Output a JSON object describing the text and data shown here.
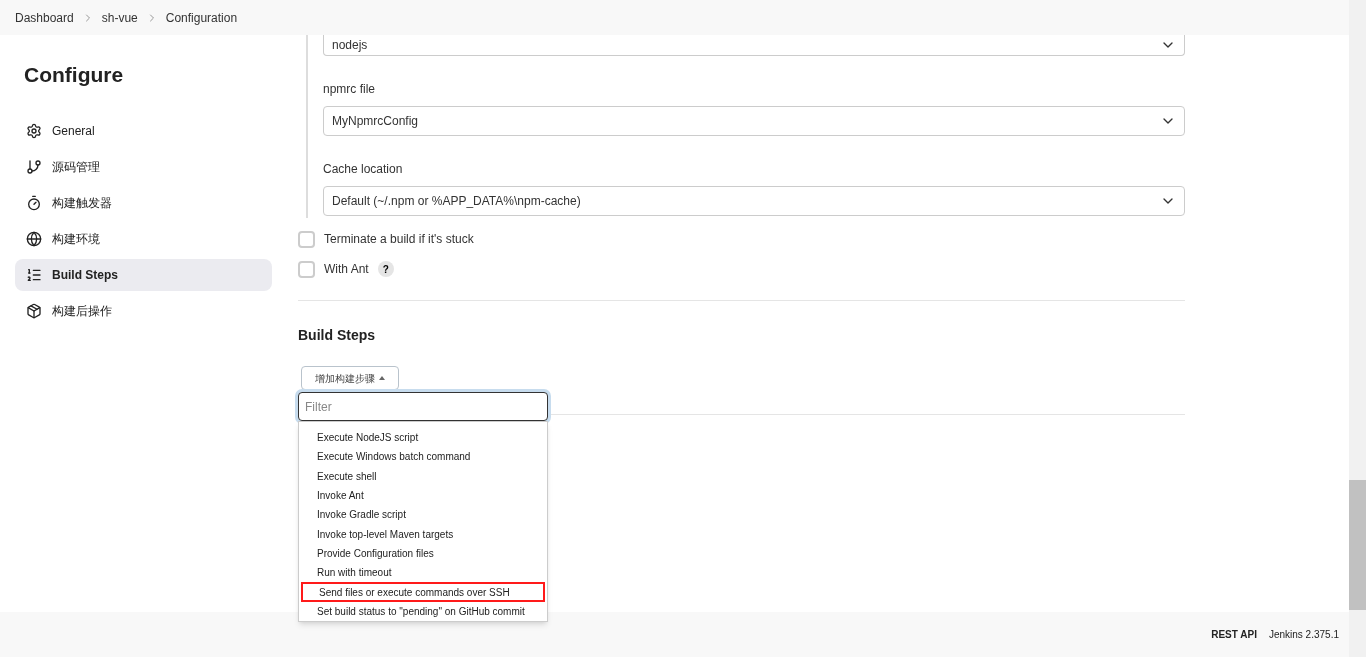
{
  "breadcrumbs": [
    "Dashboard",
    "sh-vue",
    "Configuration"
  ],
  "sidebar": {
    "title": "Configure",
    "items": [
      {
        "label": "General",
        "selected": false
      },
      {
        "label": "源码管理",
        "selected": false
      },
      {
        "label": "构建触发器",
        "selected": false
      },
      {
        "label": "构建环境",
        "selected": false
      },
      {
        "label": "Build Steps",
        "selected": true
      },
      {
        "label": "构建后操作",
        "selected": false
      }
    ]
  },
  "fields": [
    {
      "value": "nodejs"
    },
    {
      "label": "npmrc file",
      "value": "MyNpmrcConfig"
    },
    {
      "label": "Cache location",
      "value": "Default (~/.npm or %APP_DATA%\\npm-cache)"
    }
  ],
  "options": [
    {
      "label": "Terminate a build if it's stuck",
      "checked": false
    },
    {
      "label": "With Ant",
      "checked": false,
      "help_text": "?"
    }
  ],
  "section_title": "Build Steps",
  "add_button": "增加构建步骤",
  "filter": {
    "placeholder": "Filter"
  },
  "menu": [
    {
      "label": "Execute NodeJS script",
      "highlighted": false
    },
    {
      "label": "Execute Windows batch command",
      "highlighted": false
    },
    {
      "label": "Execute shell",
      "highlighted": false
    },
    {
      "label": "Invoke Ant",
      "highlighted": false
    },
    {
      "label": "Invoke Gradle script",
      "highlighted": false
    },
    {
      "label": "Invoke top-level Maven targets",
      "highlighted": false
    },
    {
      "label": "Provide Configuration files",
      "highlighted": false
    },
    {
      "label": "Run with timeout",
      "highlighted": false
    },
    {
      "label": "Send files or execute commands over SSH",
      "highlighted": true
    },
    {
      "label": "Set build status to \"pending\" on GitHub commit",
      "highlighted": false
    }
  ],
  "footer": [
    "REST API",
    "Jenkins 2.375.1"
  ]
}
